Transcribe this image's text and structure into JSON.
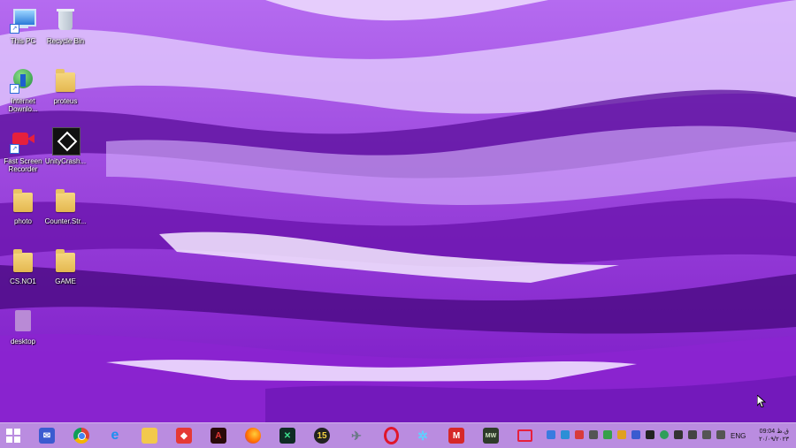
{
  "desktop": {
    "icons": [
      {
        "label": "This PC",
        "icon": "computer-icon"
      },
      {
        "label": "Recycle Bin",
        "icon": "recycle-bin-icon"
      },
      {
        "label": "Internet Downlo...",
        "icon": "internet-download-manager-icon"
      },
      {
        "label": "proteus",
        "icon": "folder-icon"
      },
      {
        "label": "Fast Screen Recorder",
        "icon": "screen-recorder-icon"
      },
      {
        "label": "UnityCrash...",
        "icon": "unity-icon"
      },
      {
        "label": "photo",
        "icon": "folder-icon"
      },
      {
        "label": "Counter.Str...",
        "icon": "folder-icon"
      },
      {
        "label": "CS.NO1",
        "icon": "folder-icon"
      },
      {
        "label": "GAME",
        "icon": "folder-icon"
      },
      {
        "label": "desktop",
        "icon": "file-icon"
      }
    ]
  },
  "taskbar": {
    "apps": [
      "windows-start-icon",
      "mail-icon",
      "chrome-icon",
      "internet-explorer-icon",
      "file-explorer-icon",
      "anydesk-icon",
      "acrobat-icon",
      "firefox-icon",
      "terminal-app-icon",
      "game-15-icon",
      "airplane-app-icon",
      "opera-icon",
      "atom-app-icon",
      "mario-game-icon",
      "mw-game-icon",
      "screen-recorder-taskbar-icon"
    ],
    "language": "ENG",
    "clock_time": "09:04 ق.ظ",
    "clock_date": "۲۰/۰۹/۲۰۲۳"
  },
  "colors": {
    "wallpaper_base": "#8a1fd0",
    "wallpaper_dark": "#5a0d9a",
    "wallpaper_light": "#e8d6ff",
    "taskbar": "#be96e1"
  }
}
